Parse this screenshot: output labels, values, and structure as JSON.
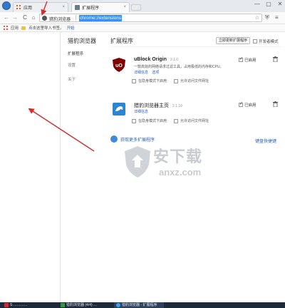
{
  "tabs": [
    {
      "title": "应用",
      "close": "×"
    },
    {
      "title": "扩展程序",
      "close": "×"
    }
  ],
  "window_controls": [
    "—",
    "▢",
    "✕"
  ],
  "toolbar": {
    "back": "←",
    "forward": "→",
    "reload": "C",
    "home": "⌂",
    "site_label": "猎豹浏览器",
    "url": "chrome://extensions",
    "star": "☆"
  },
  "bookmarks": {
    "apps_label": "应用",
    "import_text": "点击这里导入书签。",
    "start_link": "开始"
  },
  "sidebar": {
    "title": "猎豹浏览器",
    "items": [
      {
        "label": "扩展程序",
        "active": true
      },
      {
        "label": "设置",
        "active": false
      },
      {
        "label": "关于",
        "active": false
      }
    ]
  },
  "main": {
    "title": "扩展程序",
    "update_button": "立即更新扩展程序",
    "developer_mode_label": "开发者模式",
    "developer_mode_checked": false
  },
  "extensions": [
    {
      "name": "uBlock Origin",
      "version": "3.1.0",
      "description": "一款高效的网络请求过滤工具，占用极低的内存和CPU。",
      "links": [
        "详细信息",
        "选项"
      ],
      "options": [
        "在隐身模式下启用",
        "允许访问文件网址"
      ],
      "enabled_label": "已启用",
      "enabled": true,
      "icon": "ublock-icon",
      "icon_color": "#800000"
    },
    {
      "name": "猎豹浏览器主页",
      "version": "2.1.10",
      "description": "",
      "links": [
        "详细信息"
      ],
      "options": [
        "在隐身模式下启用",
        "允许访问文件网址"
      ],
      "enabled_label": "已启用",
      "enabled": true,
      "icon": "cheetah-icon",
      "icon_color": "#2b86d1"
    }
  ],
  "footer": {
    "more_extensions": "获取更多扩展程序",
    "keyboard_shortcuts": "键盘快捷键"
  },
  "watermark": {
    "cn": "安下载",
    "en": "anxz.com"
  },
  "taskbar": [
    {
      "label": "S …………"
    },
    {
      "label": "猎豹浏览器 (4/4) …"
    },
    {
      "label": "猎豹浏览器 - 扩展程序"
    }
  ],
  "colors": {
    "accent": "#2a64c2",
    "url_highlight": "#3390ff",
    "arrow": "#d62c2c"
  }
}
